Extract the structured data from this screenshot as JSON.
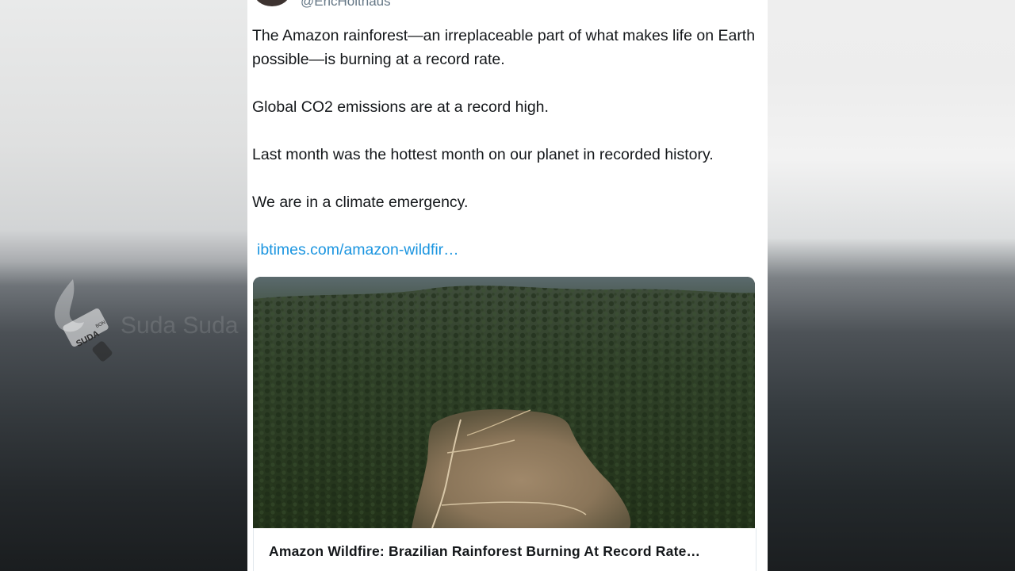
{
  "tweet": {
    "handle": "@EricHolthaus",
    "paragraphs": [
      "The Amazon rainforest—an irreplaceable part of what makes life on Earth possible—is burning at a record rate.",
      "Global CO2 emissions are at a record high.",
      "Last month was the hottest month on our planet in recorded history.",
      "We are in a climate emergency."
    ],
    "link_text": "ibtimes.com/amazon-wildfir…",
    "card_title": "Amazon Wildfire: Brazilian Rainforest Burning At Record Rate…"
  },
  "watermark": {
    "badge_text": "SUDA",
    "badge_subtext": "BON",
    "text": "Suda Suda"
  },
  "colors": {
    "link": "#1b95e0",
    "text": "#14171a",
    "handle": "#657786"
  }
}
